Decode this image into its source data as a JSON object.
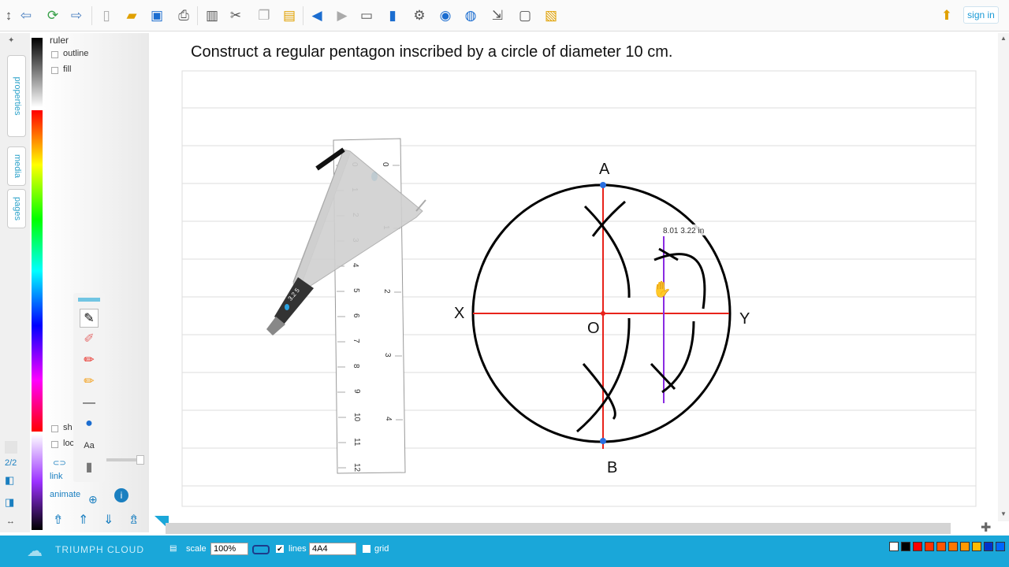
{
  "toolbar": {
    "signin_label": "sign in",
    "icons": [
      "move-icon",
      "back-icon",
      "refresh-icon",
      "forward-icon",
      "new-page-icon",
      "open-folder-icon",
      "save-icon",
      "print-icon",
      "trash-icon",
      "tools-icon",
      "copy-icon",
      "paste-icon",
      "undo-icon",
      "redo-icon",
      "window-icon",
      "chart-icon",
      "settings-icon",
      "globe-icon",
      "chat-icon",
      "share-icon",
      "screen-icon",
      "note-icon",
      "upload-icon"
    ]
  },
  "sidebar": {
    "tabs": [
      "properties",
      "media",
      "pages"
    ],
    "page_count": "2/2"
  },
  "props": {
    "title": "ruler",
    "outline_label": "outline",
    "fill_label": "fill",
    "sh_label": "sh",
    "loc_label": "loc",
    "link_label": "link",
    "animate_label": "animate"
  },
  "canvas": {
    "title": "Construct a regular pentagon inscribed by a circle of diameter 10 cm.",
    "labels": {
      "A": "A",
      "B": "B",
      "X": "X",
      "Y": "Y",
      "O": "O"
    },
    "coord_tooltip": "8.01 3.22 in",
    "ruler_numbers_cm": [
      "0",
      "1",
      "2",
      "3",
      "4",
      "5",
      "6",
      "7",
      "8",
      "9",
      "10",
      "11",
      "12"
    ],
    "ruler_numbers_in": [
      "0",
      "1",
      "2",
      "3",
      "4"
    ],
    "compass_readout": "3.2 5"
  },
  "statusbar": {
    "brand": "TRIUMPH CLOUD",
    "scale_label": "scale",
    "scale_value": "100%",
    "lines_label": "lines",
    "lines_value": "4A4",
    "grid_label": "grid",
    "swatch_colors": [
      "#ffffff",
      "#000000",
      "#ff0000",
      "#ff3300",
      "#ff5500",
      "#ff7700",
      "#ff9900",
      "#ffbb00",
      "#0033cc",
      "#0066ff"
    ]
  },
  "colors": {
    "accent": "#1aa7d9",
    "construction_red": "#e8231b",
    "bisector_purple": "#8a2be2"
  }
}
